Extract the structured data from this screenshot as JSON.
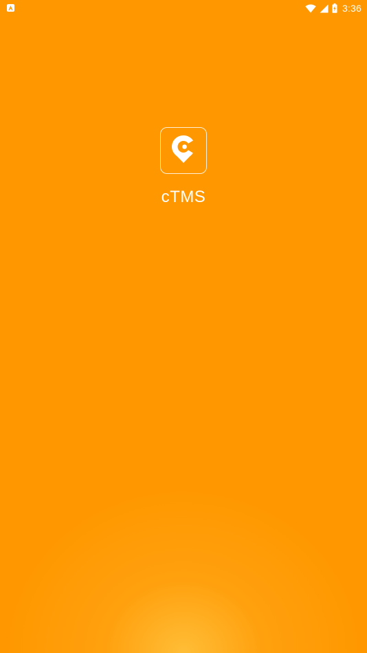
{
  "status_bar": {
    "time": "3:36",
    "icons": [
      "notification-a-icon",
      "wifi-icon",
      "cellular-signal-icon",
      "battery-icon"
    ]
  },
  "splash": {
    "app_name": "cTMS",
    "logo_icon": "location-pin-c-icon"
  },
  "colors": {
    "background": "#FF9800",
    "glow": "#FFC440",
    "foreground": "#FFFFFF"
  }
}
